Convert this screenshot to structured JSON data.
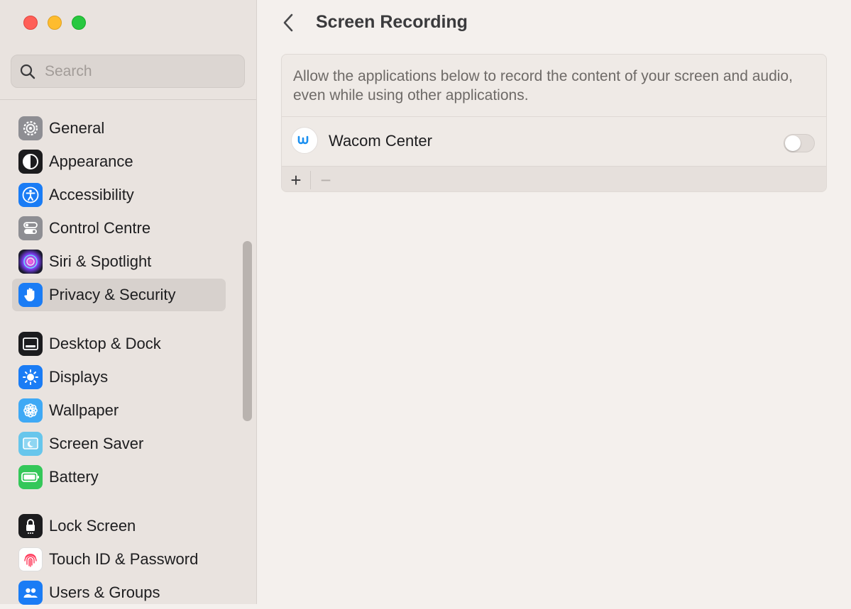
{
  "window": {
    "title": "Screen Recording"
  },
  "search": {
    "placeholder": "Search",
    "value": ""
  },
  "sidebar": {
    "items": [
      {
        "label": "General",
        "icon": "gear-icon",
        "color": "#8e8e93"
      },
      {
        "label": "Appearance",
        "icon": "appearance-icon",
        "color": "#1c1c1e"
      },
      {
        "label": "Accessibility",
        "icon": "accessibility-icon",
        "color": "#1a7cf5"
      },
      {
        "label": "Control Centre",
        "icon": "control-centre-icon",
        "color": "#8e8e93"
      },
      {
        "label": "Siri & Spotlight",
        "icon": "siri-icon",
        "color": "#6a3cc9"
      },
      {
        "label": "Privacy & Security",
        "icon": "hand-icon",
        "color": "#1a7cf5",
        "selected": true
      },
      {
        "label": "Desktop & Dock",
        "icon": "dock-icon",
        "color": "#1c1c1e"
      },
      {
        "label": "Displays",
        "icon": "sun-icon",
        "color": "#1a7cf5"
      },
      {
        "label": "Wallpaper",
        "icon": "flower-icon",
        "color": "#3fa9f5"
      },
      {
        "label": "Screen Saver",
        "icon": "screen-saver-icon",
        "color": "#4fb8e8"
      },
      {
        "label": "Battery",
        "icon": "battery-icon",
        "color": "#34c759"
      },
      {
        "label": "Lock Screen",
        "icon": "lock-icon",
        "color": "#1c1c1e"
      },
      {
        "label": "Touch ID & Password",
        "icon": "fingerprint-icon",
        "color": "#ffffff"
      },
      {
        "label": "Users & Groups",
        "icon": "users-icon",
        "color": "#1a7cf5"
      }
    ]
  },
  "main": {
    "description": "Allow the applications below to record the content of your screen and audio, even while using other applications.",
    "apps": [
      {
        "name": "Wacom Center",
        "enabled": false,
        "icon_letter": "W"
      }
    ],
    "add_label": "+",
    "remove_label": "−"
  },
  "colors": {
    "accent": "#1a7cf5",
    "close": "#ff5f57",
    "minimize": "#febc2e",
    "maximize": "#28c840"
  }
}
